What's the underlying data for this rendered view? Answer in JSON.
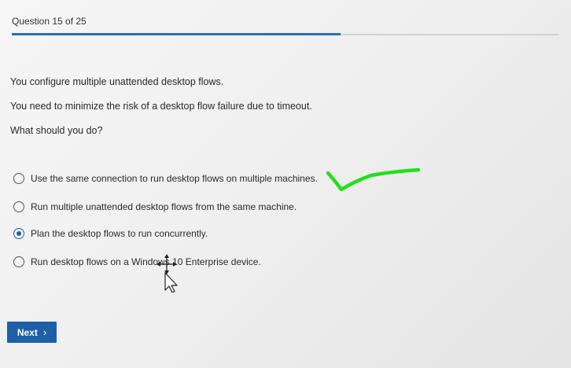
{
  "header": {
    "question_counter": "Question 15 of 25",
    "progress_fraction": 0.6
  },
  "question": {
    "scenario": "You configure multiple unattended desktop flows.",
    "goal": "You need to minimize the risk of a desktop flow failure due to timeout.",
    "prompt": "What should you do?"
  },
  "options": [
    {
      "label": "Use the same connection to run desktop flows on multiple machines.",
      "selected": false
    },
    {
      "label": "Run multiple unattended desktop flows from the same machine.",
      "selected": false
    },
    {
      "label": "Plan the desktop flows to run concurrently.",
      "selected": true
    },
    {
      "label": "Run desktop flows on a Windows 10 Enterprise device.",
      "selected": false
    }
  ],
  "footer": {
    "next_label": "Next",
    "next_icon": "chevron-right-icon"
  },
  "colors": {
    "accent": "#1f5fa8",
    "progress": "#2a6fb5",
    "annotation": "#22e01a"
  }
}
